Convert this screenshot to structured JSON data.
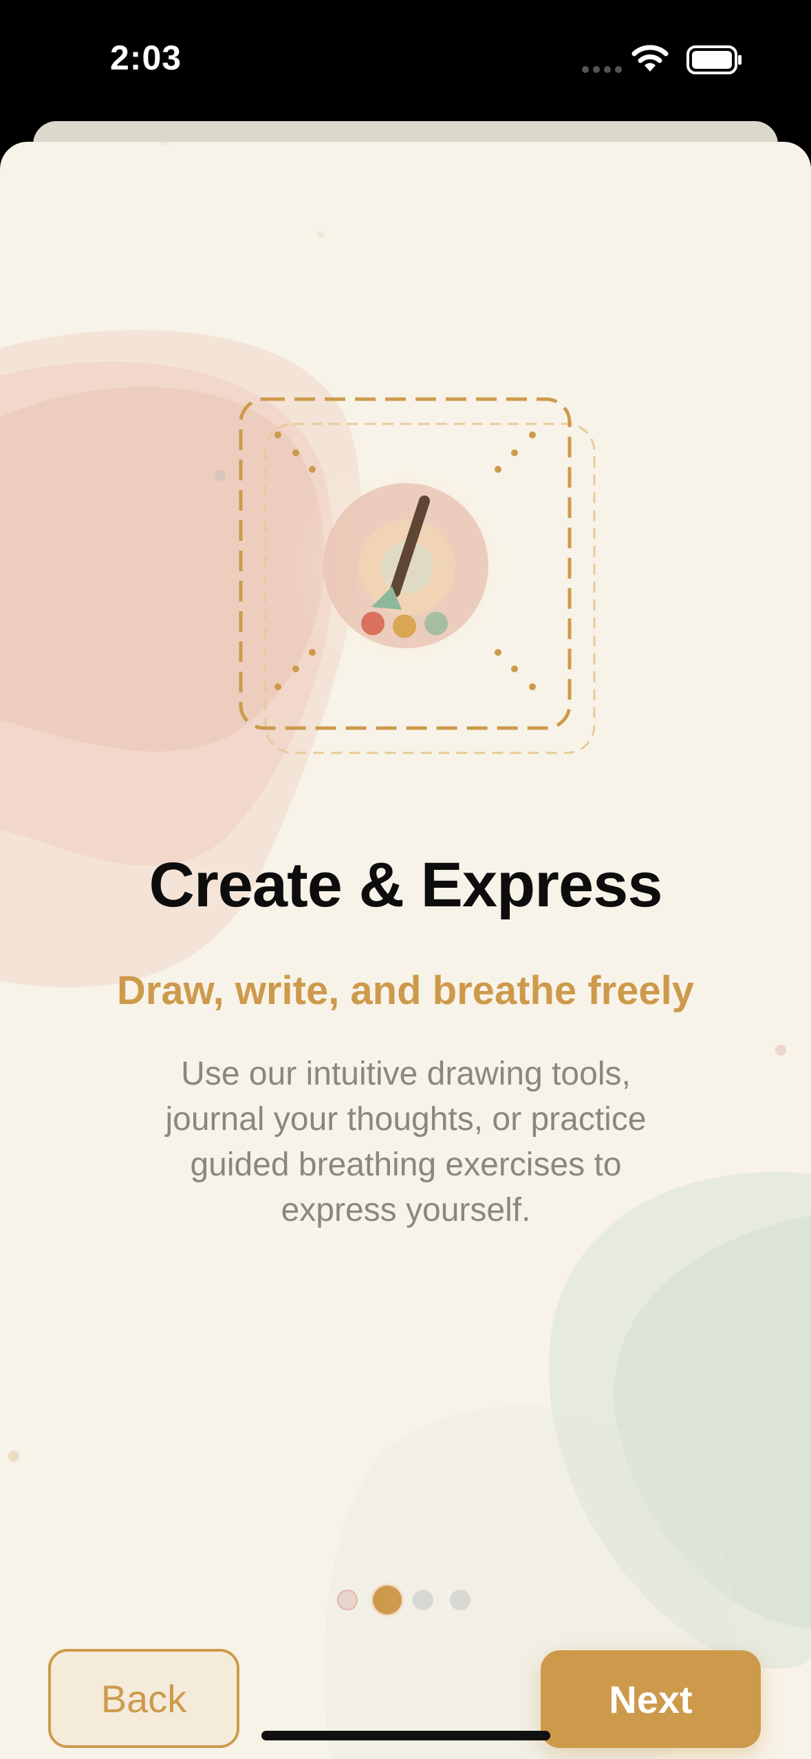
{
  "status_bar": {
    "time": "2:03"
  },
  "onboarding": {
    "title": "Create & Express",
    "subtitle": "Draw, write, and breathe freely",
    "body": "Use our intuitive drawing tools, journal your thoughts, or practice guided breathing exercises to express yourself.",
    "page_indicator": {
      "current_page": 2,
      "total_pages": 4
    },
    "back_label": "Back",
    "next_label": "Next",
    "illustration_icon": "paintbrush-palette-icon"
  },
  "colors": {
    "accent": "#cd9a4c",
    "background": "#f8f3e8",
    "title_text": "#0d0d0d",
    "body_text": "#8a8680",
    "blob_pink": "#efcdbf",
    "blob_green": "#dde5dc"
  }
}
